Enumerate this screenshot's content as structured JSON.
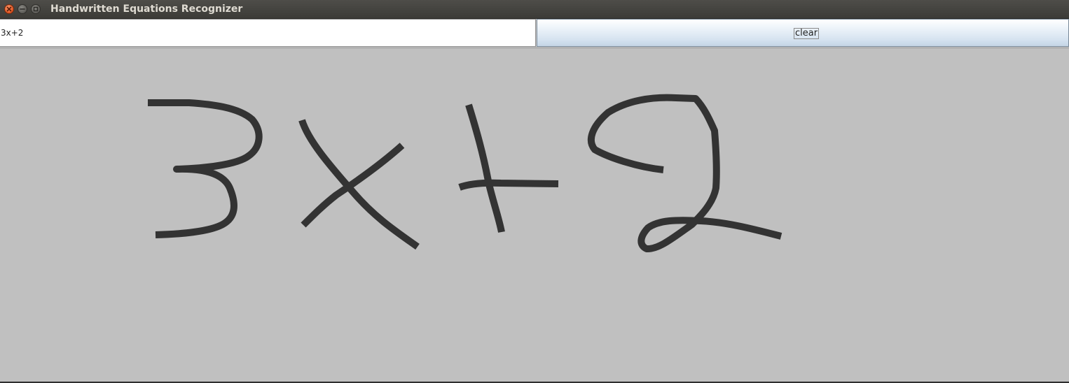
{
  "window": {
    "title": "Handwritten Equations Recognizer"
  },
  "toolbar": {
    "result_value": "3x+2",
    "clear_label": "clear"
  },
  "canvas": {
    "ink_color": "#333333",
    "background_color": "#c0c0c0",
    "strokes": [
      "digit-3",
      "letter-x",
      "plus-sign",
      "digit-2"
    ]
  },
  "colors": {
    "close_button": "#e2531f",
    "titlebar": "#3c3b37"
  }
}
